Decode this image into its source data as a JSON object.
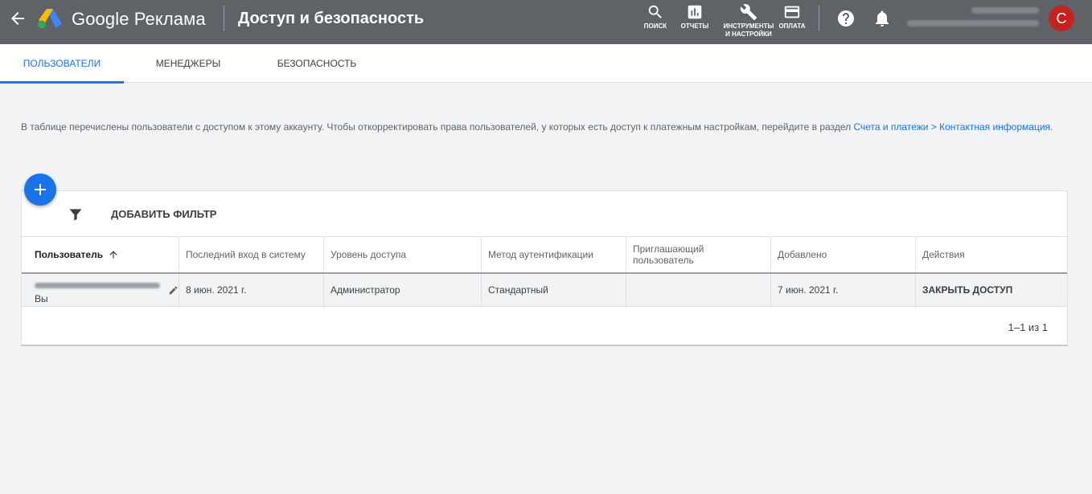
{
  "header": {
    "brand": "Google Реклама",
    "title": "Доступ и безопасность",
    "tools": [
      {
        "label": "ПОИСК",
        "icon": "search-icon"
      },
      {
        "label": "ОТЧЕТЫ",
        "icon": "reports-icon"
      },
      {
        "label": "ИНСТРУМЕНТЫ И НАСТРОЙКИ",
        "icon": "wrench-icon"
      },
      {
        "label": "ОПЛАТА",
        "icon": "credit-card-icon"
      }
    ],
    "avatar_letter": "С"
  },
  "tabs": [
    {
      "label": "ПОЛЬЗОВАТЕЛИ",
      "active": true
    },
    {
      "label": "МЕНЕДЖЕРЫ",
      "active": false
    },
    {
      "label": "БЕЗОПАСНОСТЬ",
      "active": false
    }
  ],
  "info": {
    "text": "В таблице перечислены пользователи с доступом к этому аккаунту. Чтобы откорректировать права пользователей, у которых есть доступ к платежным настройкам, перейдите в раздел ",
    "link": "Счета и платежи > Контактная информация",
    "suffix": "."
  },
  "filter": {
    "label": "ДОБАВИТЬ ФИЛЬТР"
  },
  "table": {
    "columns": [
      "Пользователь",
      "Последний вход в систему",
      "Уровень доступа",
      "Метод аутентификации",
      "Приглашающий пользователь",
      "Добавлено",
      "Действия"
    ],
    "rows": [
      {
        "user_note": "Вы",
        "last_login": "8 июн. 2021 г.",
        "access_level": "Администратор",
        "auth_method": "Стандартный",
        "inviter": "",
        "added": "7 июн. 2021 г.",
        "action": "ЗАКРЫТЬ ДОСТУП"
      }
    ]
  },
  "pagination": "1–1 из 1",
  "colors": {
    "header_bg": "#5f6368",
    "accent": "#1a73e8",
    "avatar": "#c5221f",
    "page_bg": "#f1f3f4"
  }
}
